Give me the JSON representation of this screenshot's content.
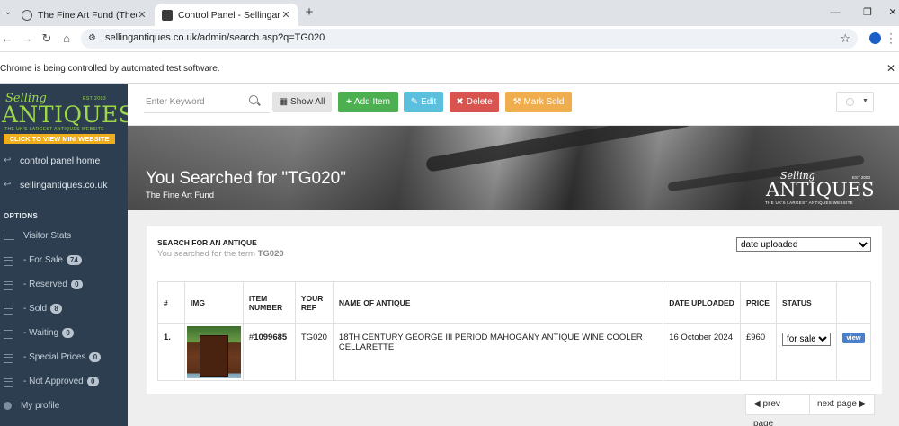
{
  "browser": {
    "tabs": [
      {
        "title": "The Fine Art Fund (Theo Hare)",
        "close": "✕"
      },
      {
        "title": "Control Panel - Sellingantiques",
        "close": "✕"
      }
    ],
    "new_tab": "+",
    "url": "sellingantiques.co.uk/admin/search.asp?q=TG020",
    "automation_notice": "Chrome is being controlled by automated test software.",
    "infobar_close": "✕"
  },
  "sidebar": {
    "logo": {
      "top": "Selling",
      "est": "EST 2003",
      "main": "ANTIQUES",
      "tagline": "THE UK'S LARGEST ANTIQUES WEBSITE",
      "cta": "CLICK TO VIEW MINI WEBSITE"
    },
    "links": [
      {
        "label": "control panel home"
      },
      {
        "label": "sellingantiques.co.uk"
      }
    ],
    "options_heading": "OPTIONS",
    "items": [
      {
        "label": "Visitor Stats",
        "badge": ""
      },
      {
        "label": "- For Sale",
        "badge": "74"
      },
      {
        "label": "- Reserved",
        "badge": "0"
      },
      {
        "label": "- Sold",
        "badge": "8"
      },
      {
        "label": "- Waiting",
        "badge": "0"
      },
      {
        "label": "- Special Prices",
        "badge": "0"
      },
      {
        "label": "- Not Approved",
        "badge": "0"
      },
      {
        "label": "My profile",
        "badge": ""
      }
    ]
  },
  "toolbar": {
    "search_placeholder": "Enter Keyword",
    "show_all": "Show All",
    "add_item": "Add Item",
    "edit": "Edit",
    "delete": "Delete",
    "mark_sold": "Mark Sold"
  },
  "hero": {
    "title": "You Searched for \"TG020\"",
    "subtitle": "The Fine Art Fund",
    "logo_top": "Selling",
    "logo_est": "EST 2003",
    "logo_main": "ANTIQUES",
    "logo_tag": "THE UK'S LARGEST ANTIQUES WEBSITE"
  },
  "search_panel": {
    "title": "SEARCH FOR AN ANTIQUE",
    "subtitle_prefix": "You searched for the term ",
    "term": "TG020",
    "sort_selected": "date uploaded"
  },
  "table": {
    "headers": [
      "#",
      "IMG",
      "ITEM NUMBER",
      "YOUR REF",
      "NAME OF ANTIQUE",
      "DATE UPLOADED",
      "PRICE",
      "STATUS",
      ""
    ],
    "header_item_1": "ITEM",
    "header_item_2": "NUMBER",
    "header_ref_1": "YOUR",
    "header_ref_2": "REF",
    "rows": [
      {
        "index": "1.",
        "item_prefix": "#",
        "item_number": "1099685",
        "ref": "TG020",
        "name": "18TH CENTURY GEORGE III PERIOD MAHOGANY ANTIQUE WINE COOLER CELLARETTE",
        "date": "16 October 2024",
        "price": "£960",
        "status": "for sale",
        "action": "view"
      }
    ]
  },
  "pager": {
    "prev": "prev page",
    "next": "next page"
  },
  "colors": {
    "sidebar_bg": "#2c3e50",
    "logo_green": "#9dd84a",
    "cta_orange": "#f0ad1c",
    "add_green": "#4caf50",
    "edit_blue": "#5bc0de",
    "delete_red": "#d9534f",
    "sold_orange": "#f0ad4e",
    "view_blue": "#4a7fc9"
  }
}
